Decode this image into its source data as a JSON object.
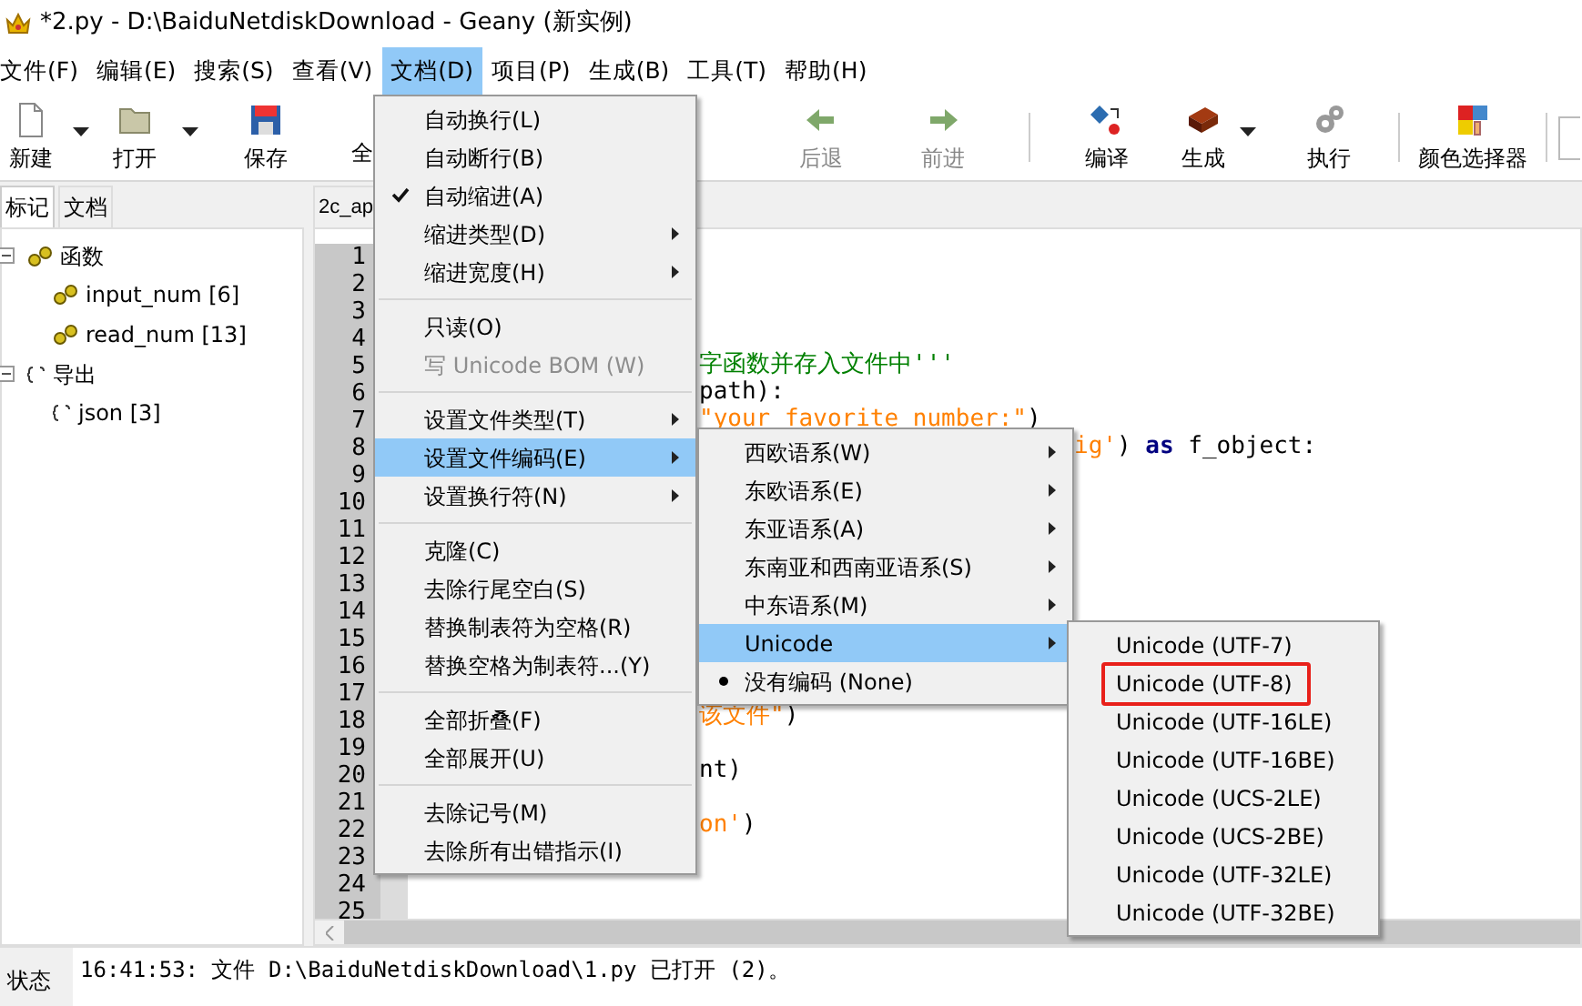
{
  "window": {
    "title": "*2.py - D:\\BaiduNetdiskDownload - Geany (新实例)"
  },
  "menu_bar": [
    {
      "label": "文件(F)",
      "selected": false
    },
    {
      "label": "编辑(E)",
      "selected": false
    },
    {
      "label": "搜索(S)",
      "selected": false
    },
    {
      "label": "查看(V)",
      "selected": false
    },
    {
      "label": "文档(D)",
      "selected": true
    },
    {
      "label": "项目(P)",
      "selected": false
    },
    {
      "label": "生成(B)",
      "selected": false
    },
    {
      "label": "工具(T)",
      "selected": false
    },
    {
      "label": "帮助(H)",
      "selected": false
    }
  ],
  "toolbar": [
    {
      "kind": "new",
      "label": "新建",
      "disabled": false
    },
    {
      "kind": "dropdown"
    },
    {
      "kind": "open",
      "label": "打开",
      "disabled": false
    },
    {
      "kind": "dropdown"
    },
    {
      "kind": "save",
      "label": "保存",
      "disabled": false
    },
    {
      "kind": "partial",
      "label": "全",
      "disabled": false
    },
    {
      "kind": "back",
      "label": "后退",
      "disabled": true
    },
    {
      "kind": "forward",
      "label": "前进",
      "disabled": true
    },
    {
      "kind": "separator"
    },
    {
      "kind": "compile",
      "label": "编译",
      "disabled": false
    },
    {
      "kind": "build",
      "label": "生成",
      "disabled": false
    },
    {
      "kind": "dropdown"
    },
    {
      "kind": "run",
      "label": "执行",
      "disabled": false
    },
    {
      "kind": "separator"
    },
    {
      "kind": "color",
      "label": "颜色选择器",
      "disabled": false
    },
    {
      "kind": "separator"
    },
    {
      "kind": "field"
    }
  ],
  "sidebar": {
    "tabs": [
      {
        "label": "标记",
        "selected": true
      },
      {
        "label": "文档",
        "selected": false
      }
    ],
    "tree": [
      {
        "label": "函数",
        "kind": "functions",
        "expanded": true,
        "children": [
          {
            "label": "input_num [6]"
          },
          {
            "label": "read_num [13]"
          }
        ]
      },
      {
        "label": "导出",
        "kind": "imports",
        "expanded": true,
        "children": [
          {
            "label": "json [3]"
          }
        ]
      }
    ]
  },
  "editor": {
    "tab": {
      "label": "2c_ap"
    },
    "lines": [
      {
        "number": "1"
      },
      {
        "number": "2"
      },
      {
        "number": "3"
      },
      {
        "number": "4"
      },
      {
        "number": "5",
        "segments": [
          {
            "kind": "comment",
            "text": "字函数并存入文件中'''"
          }
        ]
      },
      {
        "number": "6",
        "segments": [
          {
            "kind": "plain",
            "text": "path):"
          }
        ]
      },
      {
        "number": "7",
        "segments": [
          {
            "kind": "string",
            "text": "\"your favorite number:\""
          },
          {
            "kind": "plain",
            "text": ")"
          }
        ]
      },
      {
        "number": "8",
        "behind_submenu": true,
        "segments": [
          {
            "kind": "string",
            "text": "ig'"
          },
          {
            "kind": "plain",
            "text": ") "
          },
          {
            "kind": "keyword",
            "text": "as"
          },
          {
            "kind": "plain",
            "text": " f_object:"
          }
        ]
      },
      {
        "number": "9"
      },
      {
        "number": "10"
      },
      {
        "number": "11"
      },
      {
        "number": "12"
      },
      {
        "number": "13"
      },
      {
        "number": "14"
      },
      {
        "number": "15"
      },
      {
        "number": "16"
      },
      {
        "number": "17"
      },
      {
        "number": "18",
        "segments": [
          {
            "kind": "string",
            "text": "该文件\""
          },
          {
            "kind": "plain",
            "text": ")"
          }
        ]
      },
      {
        "number": "19"
      },
      {
        "number": "20",
        "segments": [
          {
            "kind": "plain",
            "text": "nt)"
          }
        ]
      },
      {
        "number": "21"
      },
      {
        "number": "22",
        "segments": [
          {
            "kind": "string",
            "text": "on'"
          },
          {
            "kind": "plain",
            "text": ")"
          }
        ]
      },
      {
        "number": "23"
      },
      {
        "number": "24"
      },
      {
        "number": "25"
      }
    ]
  },
  "menus": [
    {
      "items": [
        {
          "kind": "item",
          "label": "自动换行(L)",
          "checked": false,
          "highlighted": false,
          "submenu": false,
          "disabled": false
        },
        {
          "kind": "item",
          "label": "自动断行(B)",
          "checked": false,
          "highlighted": false,
          "submenu": false,
          "disabled": false
        },
        {
          "kind": "item",
          "label": "自动缩进(A)",
          "checked": true,
          "highlighted": false,
          "submenu": false,
          "disabled": false
        },
        {
          "kind": "item",
          "label": "缩进类型(D)",
          "checked": false,
          "highlighted": false,
          "submenu": true,
          "disabled": false
        },
        {
          "kind": "item",
          "label": "缩进宽度(H)",
          "checked": false,
          "highlighted": false,
          "submenu": true,
          "disabled": false
        },
        {
          "kind": "separator"
        },
        {
          "kind": "item",
          "label": "只读(O)",
          "checked": false,
          "highlighted": false,
          "submenu": false,
          "disabled": false
        },
        {
          "kind": "item",
          "label": "写 Unicode BOM (W)",
          "checked": false,
          "highlighted": false,
          "submenu": false,
          "disabled": true
        },
        {
          "kind": "separator"
        },
        {
          "kind": "item",
          "label": "设置文件类型(T)",
          "checked": false,
          "highlighted": false,
          "submenu": true,
          "disabled": false
        },
        {
          "kind": "item",
          "label": "设置文件编码(E)",
          "checked": false,
          "highlighted": true,
          "submenu": true,
          "disabled": false
        },
        {
          "kind": "item",
          "label": "设置换行符(N)",
          "checked": false,
          "highlighted": false,
          "submenu": true,
          "disabled": false
        },
        {
          "kind": "separator"
        },
        {
          "kind": "item",
          "label": "克隆(C)",
          "checked": false,
          "highlighted": false,
          "submenu": false,
          "disabled": false
        },
        {
          "kind": "item",
          "label": "去除行尾空白(S)",
          "checked": false,
          "highlighted": false,
          "submenu": false,
          "disabled": false
        },
        {
          "kind": "item",
          "label": "替换制表符为空格(R)",
          "checked": false,
          "highlighted": false,
          "submenu": false,
          "disabled": false
        },
        {
          "kind": "item",
          "label": "替换空格为制表符...(Y)",
          "checked": false,
          "highlighted": false,
          "submenu": false,
          "disabled": false
        },
        {
          "kind": "separator"
        },
        {
          "kind": "item",
          "label": "全部折叠(F)",
          "checked": false,
          "highlighted": false,
          "submenu": false,
          "disabled": false
        },
        {
          "kind": "item",
          "label": "全部展开(U)",
          "checked": false,
          "highlighted": false,
          "submenu": false,
          "disabled": false
        },
        {
          "kind": "separator"
        },
        {
          "kind": "item",
          "label": "去除记号(M)",
          "checked": false,
          "highlighted": false,
          "submenu": false,
          "disabled": false
        },
        {
          "kind": "item",
          "label": "去除所有出错指示(I)",
          "checked": false,
          "highlighted": false,
          "submenu": false,
          "disabled": false
        }
      ]
    },
    {
      "items": [
        {
          "kind": "item",
          "label": "西欧语系(W)",
          "checked": false,
          "highlighted": false,
          "submenu": true,
          "disabled": false
        },
        {
          "kind": "item",
          "label": "东欧语系(E)",
          "checked": false,
          "highlighted": false,
          "submenu": true,
          "disabled": false
        },
        {
          "kind": "item",
          "label": "东亚语系(A)",
          "checked": false,
          "highlighted": false,
          "submenu": true,
          "disabled": false
        },
        {
          "kind": "item",
          "label": "东南亚和西南亚语系(S)",
          "checked": false,
          "highlighted": false,
          "submenu": true,
          "disabled": false
        },
        {
          "kind": "item",
          "label": "中东语系(M)",
          "checked": false,
          "highlighted": false,
          "submenu": true,
          "disabled": false
        },
        {
          "kind": "item",
          "label": "Unicode",
          "checked": false,
          "highlighted": true,
          "submenu": true,
          "disabled": false
        },
        {
          "kind": "item",
          "label": "没有编码 (None)",
          "checked": true,
          "highlighted": false,
          "submenu": false,
          "disabled": false
        }
      ]
    },
    {
      "items": [
        {
          "kind": "item",
          "label": "Unicode (UTF-7)",
          "boxed": false
        },
        {
          "kind": "item",
          "label": "Unicode (UTF-8)",
          "boxed": true
        },
        {
          "kind": "item",
          "label": "Unicode (UTF-16LE)",
          "boxed": false
        },
        {
          "kind": "item",
          "label": "Unicode (UTF-16BE)",
          "boxed": false
        },
        {
          "kind": "item",
          "label": "Unicode (UCS-2LE)",
          "boxed": false
        },
        {
          "kind": "item",
          "label": "Unicode (UCS-2BE)",
          "boxed": false
        },
        {
          "kind": "item",
          "label": "Unicode (UTF-32LE)",
          "boxed": false
        },
        {
          "kind": "item",
          "label": "Unicode (UTF-32BE)",
          "boxed": false
        }
      ]
    }
  ],
  "status": {
    "tab": "状态",
    "messages": [
      "16:41:53: 文件 D:\\BaiduNetdiskDownload\\1.py 已打开 (2)。"
    ]
  }
}
